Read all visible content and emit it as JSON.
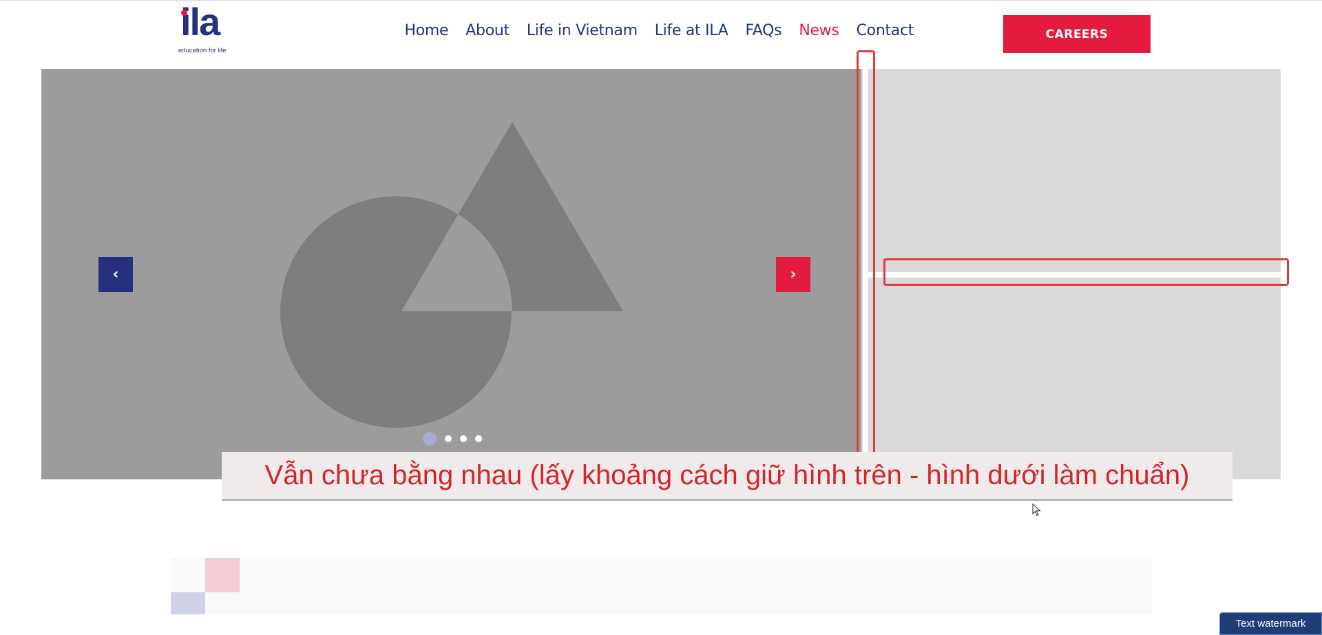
{
  "brand": {
    "logo_text": "ila",
    "tagline": "education for life"
  },
  "nav": {
    "items": [
      {
        "label": "Home"
      },
      {
        "label": "About"
      },
      {
        "label": "Life in Vietnam"
      },
      {
        "label": "Life at ILA"
      },
      {
        "label": "FAQs"
      },
      {
        "label": "News"
      },
      {
        "label": "Contact"
      }
    ],
    "active": "News"
  },
  "header": {
    "careers_label": "CAREERS"
  },
  "hero": {
    "prev_icon": "chevron-left-icon",
    "next_icon": "chevron-right-icon",
    "prev_glyph": "‹",
    "next_glyph": "›",
    "slide_count": 4,
    "active_slide": 1
  },
  "annotation": {
    "note": "Vẫn chưa bằng nhau (lấy khoảng cách giữ hình trên - hình dưới làm chuẩn)"
  },
  "watermark": {
    "label": "Text watermark"
  },
  "colors": {
    "brand_blue": "#25317e",
    "brand_red": "#e31b3e",
    "annotation_red": "#e03a40",
    "placeholder_gray": "#9c9c9c",
    "placeholder_light": "#d9d9d9"
  }
}
